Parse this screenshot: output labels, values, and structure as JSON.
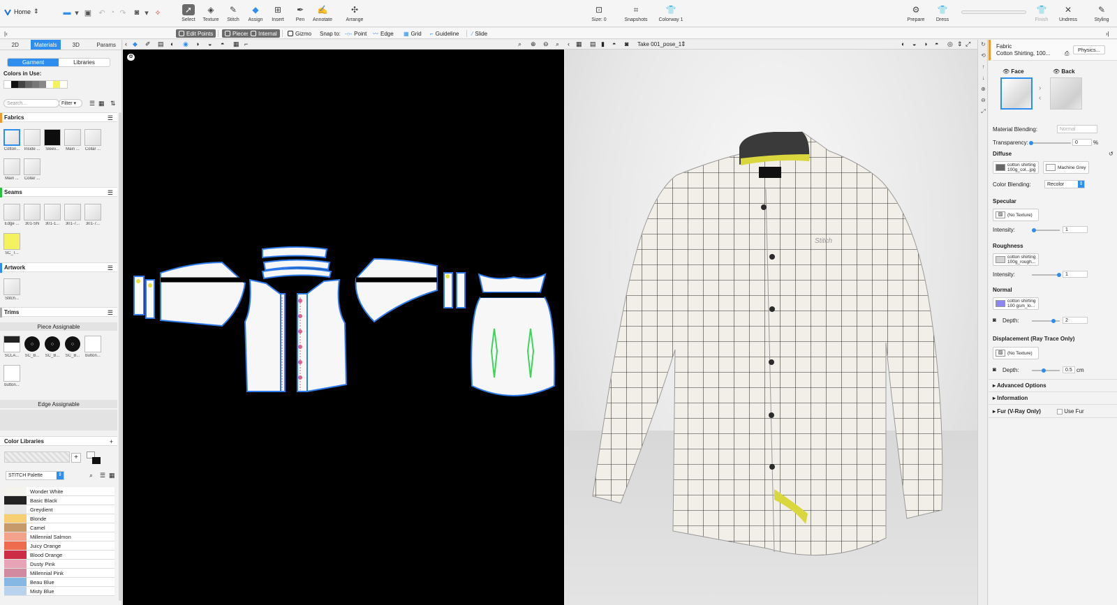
{
  "topbar": {
    "home_label": "Home",
    "tools": [
      {
        "label": "Select",
        "icon": "select-arrow-icon"
      },
      {
        "label": "Texture",
        "icon": "texture-icon"
      },
      {
        "label": "Stitch",
        "icon": "stitch-icon"
      },
      {
        "label": "Assign",
        "icon": "assign-icon"
      },
      {
        "label": "Insert",
        "icon": "insert-icon"
      },
      {
        "label": "Pen",
        "icon": "pen-icon"
      },
      {
        "label": "Annotate",
        "icon": "annotate-icon"
      },
      {
        "label": "Arrange",
        "icon": "arrange-icon"
      }
    ],
    "size_label": "Size: 0",
    "snapshots_label": "Snapshots",
    "colorway_label": "Colorway 1",
    "prepare_label": "Prepare",
    "dress_label": "Dress",
    "finish_label": "Finish",
    "undress_label": "Undress",
    "styling_label": "Styling"
  },
  "bar2": {
    "edit_points": "Edit Points",
    "pieces": "Pieces",
    "internal": "Internal",
    "gizmo": "Gizmo",
    "snap_to": "Snap to:",
    "point": "Point",
    "edge": "Edge",
    "grid": "Grid",
    "guideline": "Guideline",
    "slide": "Slide"
  },
  "left": {
    "tabs": [
      "2D",
      "Materials",
      "3D",
      "Params"
    ],
    "active_tab": "Materials",
    "seg": [
      "Garment",
      "Libraries"
    ],
    "colors_in_use_label": "Colors in Use:",
    "colors_in_use": [
      "#ffffff",
      "#111111",
      "#444444",
      "#666666",
      "#777777",
      "#888888",
      "#ffffff",
      "#f4f25e",
      "#ffffff"
    ],
    "search_placeholder": "Search...",
    "filter_label": "Filter",
    "fabrics_title": "Fabrics",
    "fabrics": [
      "Cotton...",
      "Inside ...",
      "Sleev...",
      "Main ...",
      "Collar ...",
      "Main ...",
      "Collar ..."
    ],
    "seams_title": "Seams",
    "seams": [
      "Edge ...",
      "301-SN",
      "301-1...",
      "301-7...",
      "301-7...",
      "SC_T..."
    ],
    "artwork_title": "Artwork",
    "artwork": [
      "Stitch..."
    ],
    "trims_title": "Trims",
    "piece_assignable": "Piece Assignable",
    "trims": [
      "SCLA...",
      "SC_B...",
      "SC_B...",
      "SC_B...",
      "button...",
      "button..."
    ],
    "edge_assignable": "Edge Assignable",
    "color_libraries_title": "Color Libraries",
    "palette_name": "STITCH Palette",
    "palette": [
      {
        "name": "Wonder White",
        "color": "#f5f3ee"
      },
      {
        "name": "Basic Black",
        "color": "#222222"
      },
      {
        "name": "Greydient",
        "color": "#e6e6e6"
      },
      {
        "name": "Blonde",
        "color": "#f6cf72"
      },
      {
        "name": "Camel",
        "color": "#c79a6a"
      },
      {
        "name": "Millennial Salmon",
        "color": "#f4a28c"
      },
      {
        "name": "Juicy Orange",
        "color": "#ef6b4d"
      },
      {
        "name": "Blood Orange",
        "color": "#cc2c46"
      },
      {
        "name": "Dusty Pink",
        "color": "#e7a4b6"
      },
      {
        "name": "Millennial Pink",
        "color": "#d28aa0"
      },
      {
        "name": "Beau Blue",
        "color": "#86b8e4"
      },
      {
        "name": "Misty Blue",
        "color": "#b9d3ee"
      }
    ]
  },
  "view3d": {
    "take_label": "Take 001_pose_1",
    "logo_text": "Stitch"
  },
  "prop": {
    "header_title": "Fabric",
    "header_sub": "Cotton Shirting, 100...",
    "physics_button": "Physics...",
    "face_label": "Face",
    "back_label": "Back",
    "material_blending_label": "Material Blending:",
    "material_blending_value": "Normal",
    "transparency_label": "Transparency:",
    "transparency_value": "0",
    "transparency_unit": "%",
    "diffuse_label": "Diffuse",
    "diffuse_texture": "cotton shirting 100g_col...jpg",
    "diffuse_color_name": "Machine Grey",
    "color_blending_label": "Color Blending:",
    "color_blending_value": "Recolor",
    "specular_label": "Specular",
    "specular_texture": "(No Texture)",
    "intensity_label": "Intensity:",
    "specular_intensity": "1",
    "roughness_label": "Roughness",
    "roughness_texture": "cotton shirting 100g_rough...",
    "roughness_intensity": "1",
    "normal_label": "Normal",
    "normal_texture": "cotton shirting 100 gsm_lo...",
    "depth_label": "Depth:",
    "normal_depth": "2",
    "displacement_label": "Displacement (Ray Trace Only)",
    "displacement_texture": "(No Texture)",
    "displacement_depth": "0.5",
    "displacement_unit": "cm",
    "advanced_options": "Advanced Options",
    "information": "Information",
    "fur_label": "Fur (V-Ray Only)",
    "use_fur": "Use Fur"
  }
}
